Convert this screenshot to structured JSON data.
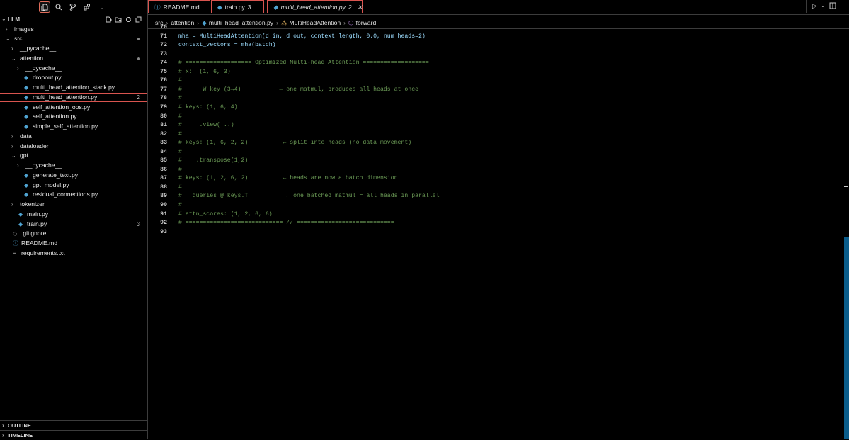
{
  "activity": {
    "icons": [
      "explorer-icon",
      "search-icon",
      "source-control-icon",
      "extensions-icon",
      "chevron-down-icon"
    ]
  },
  "explorer": {
    "root": "LLM",
    "actions": [
      "new-file-icon",
      "new-folder-icon",
      "refresh-icon",
      "collapse-icon"
    ],
    "tree": [
      {
        "label": "images",
        "type": "folder",
        "expanded": false,
        "depth": 0
      },
      {
        "label": "src",
        "type": "folder",
        "expanded": true,
        "depth": 0,
        "dot": true
      },
      {
        "label": "__pycache__",
        "type": "folder",
        "expanded": false,
        "depth": 1
      },
      {
        "label": "attention",
        "type": "folder",
        "expanded": true,
        "depth": 1,
        "dot": true
      },
      {
        "label": "__pycache__",
        "type": "folder",
        "expanded": false,
        "depth": 2
      },
      {
        "label": "dropout.py",
        "type": "py",
        "depth": 2
      },
      {
        "label": "multi_head_attention_stack.py",
        "type": "py",
        "depth": 2
      },
      {
        "label": "multi_head_attention.py",
        "type": "py",
        "depth": 2,
        "badge": "2",
        "selected": true
      },
      {
        "label": "self_attention_ops.py",
        "type": "py",
        "depth": 2
      },
      {
        "label": "self_attention.py",
        "type": "py",
        "depth": 2
      },
      {
        "label": "simple_self_attention.py",
        "type": "py",
        "depth": 2
      },
      {
        "label": "data",
        "type": "folder",
        "expanded": false,
        "depth": 1
      },
      {
        "label": "dataloader",
        "type": "folder",
        "expanded": false,
        "depth": 1
      },
      {
        "label": "gpt",
        "type": "folder",
        "expanded": true,
        "depth": 1
      },
      {
        "label": "__pycache__",
        "type": "folder",
        "expanded": false,
        "depth": 2
      },
      {
        "label": "generate_text.py",
        "type": "py",
        "depth": 2
      },
      {
        "label": "gpt_model.py",
        "type": "py",
        "depth": 2
      },
      {
        "label": "residual_connections.py",
        "type": "py",
        "depth": 2
      },
      {
        "label": "tokenizer",
        "type": "folder",
        "expanded": false,
        "depth": 1
      },
      {
        "label": "main.py",
        "type": "py",
        "depth": 1
      },
      {
        "label": "train.py",
        "type": "py",
        "depth": 1,
        "badge": "3"
      },
      {
        "label": ".gitignore",
        "type": "ignore",
        "depth": 0
      },
      {
        "label": "README.md",
        "type": "info",
        "depth": 0
      },
      {
        "label": "requirements.txt",
        "type": "txt",
        "depth": 0
      }
    ],
    "outline": "OUTLINE",
    "timeline": "TIMELINE"
  },
  "tabs": [
    {
      "label": "README.md",
      "icon": "info-icon",
      "num": ""
    },
    {
      "label": "train.py",
      "icon": "python-icon",
      "num": "3"
    },
    {
      "label": "multi_head_attention.py",
      "icon": "python-icon",
      "num": "2",
      "active": true
    }
  ],
  "breadcrumb": [
    "src",
    "attention",
    "multi_head_attention.py",
    "MultiHeadAttention",
    "forward"
  ],
  "code": {
    "lines": [
      {
        "n": "70",
        "t": ""
      },
      {
        "n": "71",
        "t": "mha = MultiHeadAttention(d_in, d_out, context_length, 0.0, num_heads=2)"
      },
      {
        "n": "72",
        "t": "context_vectors = mha(batch)"
      },
      {
        "n": "73",
        "t": ""
      },
      {
        "n": "74",
        "t": "# =================== Optimized Multi-head Attention ==================="
      },
      {
        "n": "75",
        "t": "# x:  (1, 6, 3)"
      },
      {
        "n": "76",
        "t": "#         │"
      },
      {
        "n": "77",
        "t": "#      W_key (3→4)           ← one matmul, produces all heads at once"
      },
      {
        "n": "78",
        "t": "#         │"
      },
      {
        "n": "79",
        "t": "# keys: (1, 6, 4)"
      },
      {
        "n": "80",
        "t": "#         │"
      },
      {
        "n": "81",
        "t": "#     .view(...)"
      },
      {
        "n": "82",
        "t": "#         │"
      },
      {
        "n": "83",
        "t": "# keys: (1, 6, 2, 2)          ← split into heads (no data movement)"
      },
      {
        "n": "84",
        "t": "#         │"
      },
      {
        "n": "85",
        "t": "#    .transpose(1,2)"
      },
      {
        "n": "86",
        "t": "#         │"
      },
      {
        "n": "87",
        "t": "# keys: (1, 2, 6, 2)          ← heads are now a batch dimension"
      },
      {
        "n": "88",
        "t": "#         │"
      },
      {
        "n": "89",
        "t": "#   queries @ keys.T           ← one batched matmul = all heads in parallel"
      },
      {
        "n": "90",
        "t": "#         │"
      },
      {
        "n": "91",
        "t": "# attn_scores: (1, 2, 6, 6)"
      },
      {
        "n": "92",
        "t": "# ============================ // ============================"
      },
      {
        "n": "93",
        "t": ""
      }
    ]
  }
}
